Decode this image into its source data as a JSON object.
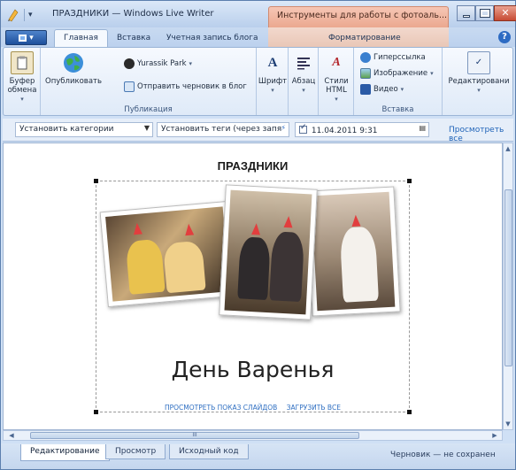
{
  "titlebar": {
    "title": "ПРАЗДНИКИ — Windows Live Writer",
    "context_tab": "Инструменты для работы с фотоаль...",
    "qat_dropdown": "▾"
  },
  "tabs": {
    "home": "Главная",
    "insert": "Вставка",
    "account": "Учетная запись блога",
    "format": "Форматирование",
    "help": "?"
  },
  "ribbon": {
    "clipboard_label": "Буфер обмена",
    "publish_label": "Опубликовать",
    "blog_name": "Yurassik Park",
    "send_draft": "Отправить черновик в блог",
    "publish_group": "Публикация",
    "font_label": "Шрифт",
    "paragraph_label": "Абзац",
    "styles_label": "Стили HTML",
    "hyperlink_label": "Гиперссылка",
    "image_label": "Изображение",
    "video_label": "Видео",
    "insert_group": "Вставка",
    "editing_label": "Редактировани"
  },
  "fields": {
    "categories": "Установить категории",
    "tags": "Установить теги (через запя",
    "date": "11.04.2011  9:31",
    "preview_link": "Просмотреть все"
  },
  "post": {
    "title": "ПРАЗДНИКИ",
    "album_title": "День Варенья",
    "slideshow_link": "ПРОСМОТРЕТЬ ПОКАЗ СЛАЙДОВ",
    "download_link": "ЗАГРУЗИТЬ ВСЕ"
  },
  "bottom": {
    "tab_edit": "Редактирование",
    "tab_preview": "Просмотр",
    "tab_source": "Исходный код",
    "status": "Черновик — не сохранен",
    "hscroll_grip": "III"
  },
  "colors": {
    "accent": "#2d6bc3",
    "context_tab": "#eba88f",
    "link": "#1f63b8"
  }
}
